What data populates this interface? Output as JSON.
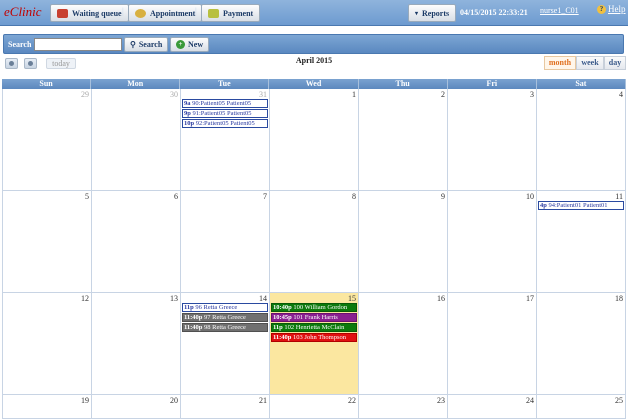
{
  "app": {
    "logo": "eClinic"
  },
  "toolbar": {
    "waiting_queue": "Waiting queue",
    "appointment": "Appointment",
    "payment": "Payment",
    "reports": "Reports",
    "datetime": "04/15/2015 22:33:21",
    "user": "nurse1_C01",
    "help": "Help"
  },
  "search": {
    "label": "Search",
    "value": "",
    "button": "Search",
    "new_button": "New"
  },
  "calendar": {
    "title": "April 2015",
    "today": "today",
    "views": [
      "month",
      "week",
      "day"
    ],
    "active_view": "month",
    "days_of_week": [
      "Sun",
      "Mon",
      "Tue",
      "Wed",
      "Thu",
      "Fri",
      "Sat"
    ],
    "weeks": [
      [
        {
          "day": "29",
          "other": true,
          "events": []
        },
        {
          "day": "30",
          "other": true,
          "events": []
        },
        {
          "day": "31",
          "other": true,
          "events": [
            {
              "time": "9a",
              "text": "90:Patient05 Patient05",
              "style": "plain"
            },
            {
              "time": "9p",
              "text": "91:Patient05 Patient05",
              "style": "plain"
            },
            {
              "time": "10p",
              "text": "92:Patient05 Patient05",
              "style": "plain"
            }
          ]
        },
        {
          "day": "1",
          "events": []
        },
        {
          "day": "2",
          "events": []
        },
        {
          "day": "3",
          "events": []
        },
        {
          "day": "4",
          "events": []
        }
      ],
      [
        {
          "day": "5",
          "events": []
        },
        {
          "day": "6",
          "events": []
        },
        {
          "day": "7",
          "events": []
        },
        {
          "day": "8",
          "events": []
        },
        {
          "day": "9",
          "events": []
        },
        {
          "day": "10",
          "events": []
        },
        {
          "day": "11",
          "events": [
            {
              "time": "4p",
              "text": "94:Patient01 Patient01",
              "style": "plain"
            }
          ]
        }
      ],
      [
        {
          "day": "12",
          "events": []
        },
        {
          "day": "13",
          "events": []
        },
        {
          "day": "14",
          "events": [
            {
              "time": "11p",
              "text": "96 Retta Greece",
              "style": "plain"
            },
            {
              "time": "11:40p",
              "text": "97 Retta Greece",
              "style": "gray"
            },
            {
              "time": "11:40p",
              "text": "98 Retta Greece",
              "style": "gray"
            }
          ]
        },
        {
          "day": "15",
          "today": true,
          "events": [
            {
              "time": "10:40p",
              "text": "100 William Gordon",
              "style": "green"
            },
            {
              "time": "10:45p",
              "text": "101 Frank Harris",
              "style": "purple"
            },
            {
              "time": "11p",
              "text": "102 Henrietta McClain",
              "style": "green"
            },
            {
              "time": "11:40p",
              "text": "103 John Thompson",
              "style": "red"
            }
          ]
        },
        {
          "day": "16",
          "events": []
        },
        {
          "day": "17",
          "events": []
        },
        {
          "day": "18",
          "events": []
        }
      ],
      [
        {
          "day": "19",
          "events": []
        },
        {
          "day": "20",
          "events": []
        },
        {
          "day": "21",
          "events": []
        },
        {
          "day": "22",
          "events": []
        },
        {
          "day": "23",
          "events": []
        },
        {
          "day": "24",
          "events": []
        },
        {
          "day": "25",
          "events": []
        }
      ]
    ]
  }
}
